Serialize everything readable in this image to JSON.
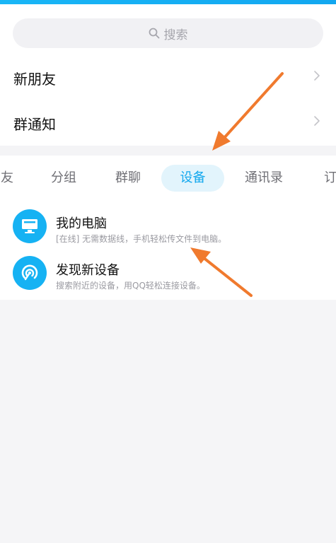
{
  "search": {
    "placeholder": "搜索"
  },
  "rows": {
    "new_friends": "新朋友",
    "group_notice": "群通知"
  },
  "tabs": [
    {
      "label": "友"
    },
    {
      "label": "分组"
    },
    {
      "label": "群聊"
    },
    {
      "label": "设备",
      "active": true
    },
    {
      "label": "通讯录"
    },
    {
      "label": "订"
    }
  ],
  "devices": [
    {
      "title": "我的电脑",
      "subtitle": "[在线] 无需数据线，手机轻松传文件到电脑。",
      "icon": "computer-icon"
    },
    {
      "title": "发现新设备",
      "subtitle": "搜索附近的设备，用QQ轻松连接设备。",
      "icon": "radar-icon"
    }
  ],
  "colors": {
    "accent": "#13a8ee",
    "annotation_arrow": "#f07a2e"
  }
}
